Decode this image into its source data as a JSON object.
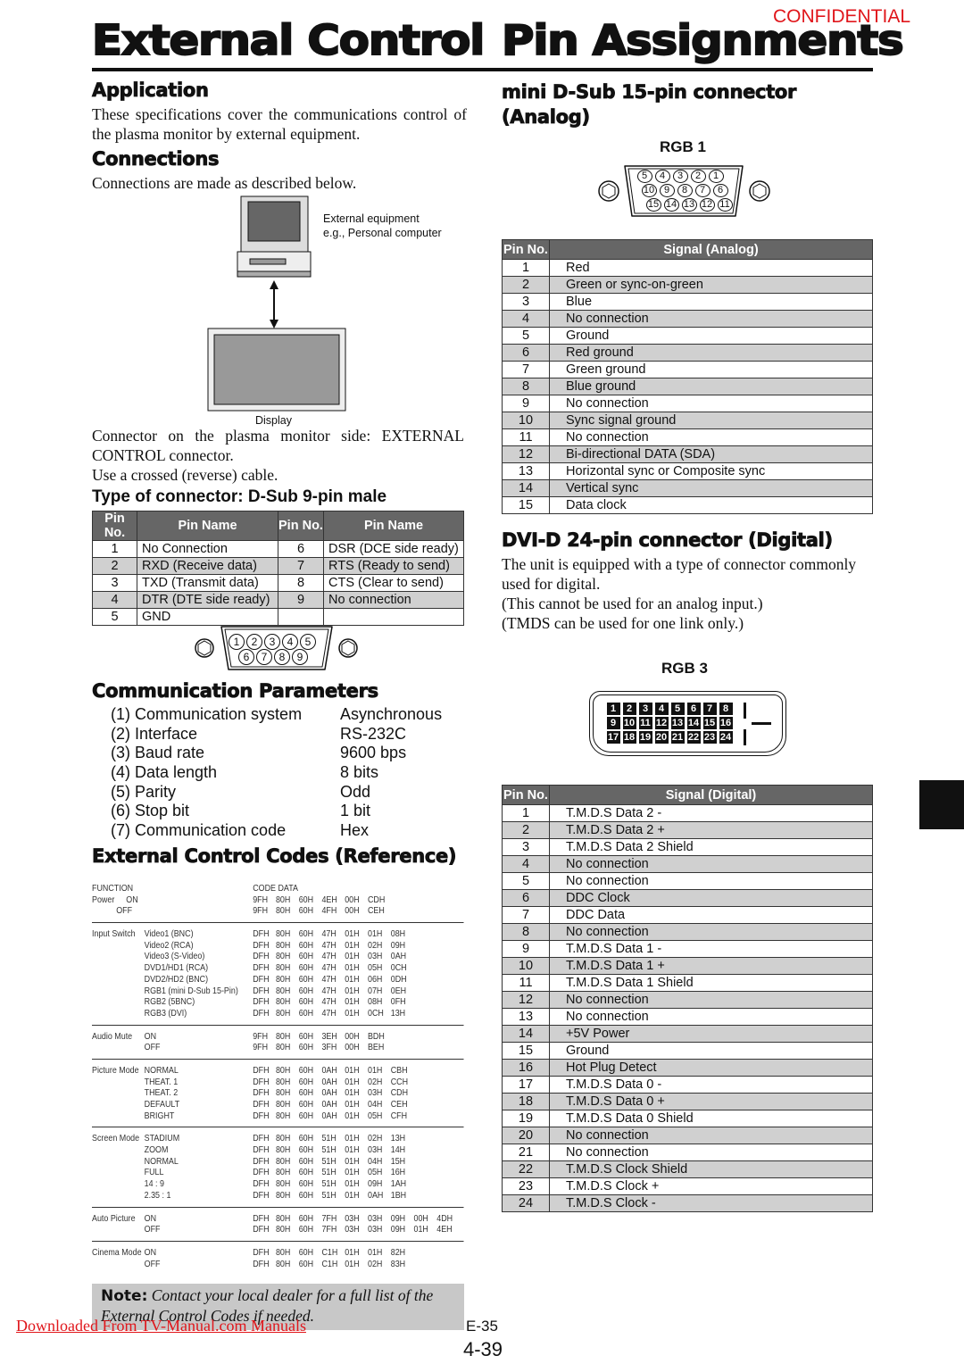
{
  "header": {
    "title_left": "External Control",
    "title_right": "Pin Assignments",
    "confidential": "CONFIDENTIAL"
  },
  "application": {
    "heading": "Application",
    "text": "These specifications cover the communications control of the plasma monitor by external equipment."
  },
  "connections": {
    "heading": "Connections",
    "text": "Connections are made as described below.",
    "equipment_label_1": "External equipment",
    "equipment_label_2": "e.g., Personal computer",
    "display_label": "Display",
    "connector_text": "Connector on the plasma monitor side: EXTERNAL CONTROL connector.",
    "cable_text": "Use a crossed (reverse) cable."
  },
  "dsub9": {
    "heading": "Type of connector: D-Sub 9-pin male",
    "headers": [
      "Pin No.",
      "Pin Name",
      "Pin No.",
      "Pin Name"
    ],
    "rows": [
      [
        "1",
        "No Connection",
        "6",
        "DSR (DCE side ready)"
      ],
      [
        "2",
        "RXD (Receive data)",
        "7",
        "RTS (Ready to send)"
      ],
      [
        "3",
        "TXD (Transmit data)",
        "8",
        "CTS (Clear to send)"
      ],
      [
        "4",
        "DTR (DTE side ready)",
        "9",
        "No connection"
      ],
      [
        "5",
        "GND",
        "",
        ""
      ]
    ],
    "pins_top": [
      "1",
      "2",
      "3",
      "4",
      "5"
    ],
    "pins_bottom": [
      "6",
      "7",
      "8",
      "9"
    ]
  },
  "comm": {
    "heading": "Communication Parameters",
    "items": [
      {
        "label": "(1) Communication system",
        "value": "Asynchronous"
      },
      {
        "label": "(2) Interface",
        "value": "RS-232C"
      },
      {
        "label": "(3) Baud rate",
        "value": "9600 bps"
      },
      {
        "label": "(4) Data length",
        "value": "8 bits"
      },
      {
        "label": "(5) Parity",
        "value": "Odd"
      },
      {
        "label": "(6) Stop bit",
        "value": "1 bit"
      },
      {
        "label": "(7) Communication code",
        "value": "Hex"
      }
    ]
  },
  "codes": {
    "heading": "External Control Codes (Reference)",
    "col_function": "FUNCTION",
    "col_code": "CODE DATA",
    "groups": [
      {
        "function": "Power",
        "entries": [
          {
            "setting": "ON",
            "codes": [
              "9FH",
              "80H",
              "60H",
              "4EH",
              "00H",
              "CDH"
            ]
          },
          {
            "setting": "OFF",
            "codes": [
              "9FH",
              "80H",
              "60H",
              "4FH",
              "00H",
              "CEH"
            ]
          }
        ]
      },
      {
        "function": "Input Switch",
        "entries": [
          {
            "setting": "Video1 (BNC)",
            "codes": [
              "DFH",
              "80H",
              "60H",
              "47H",
              "01H",
              "01H",
              "08H"
            ]
          },
          {
            "setting": "Video2 (RCA)",
            "codes": [
              "DFH",
              "80H",
              "60H",
              "47H",
              "01H",
              "02H",
              "09H"
            ]
          },
          {
            "setting": "Video3 (S-Video)",
            "codes": [
              "DFH",
              "80H",
              "60H",
              "47H",
              "01H",
              "03H",
              "0AH"
            ]
          },
          {
            "setting": "DVD1/HD1 (RCA)",
            "codes": [
              "DFH",
              "80H",
              "60H",
              "47H",
              "01H",
              "05H",
              "0CH"
            ]
          },
          {
            "setting": "DVD2/HD2 (BNC)",
            "codes": [
              "DFH",
              "80H",
              "60H",
              "47H",
              "01H",
              "06H",
              "0DH"
            ]
          },
          {
            "setting": "RGB1 (mini D-Sub 15-Pin)",
            "codes": [
              "DFH",
              "80H",
              "60H",
              "47H",
              "01H",
              "07H",
              "0EH"
            ]
          },
          {
            "setting": "RGB2 (5BNC)",
            "codes": [
              "DFH",
              "80H",
              "60H",
              "47H",
              "01H",
              "08H",
              "0FH"
            ]
          },
          {
            "setting": "RGB3 (DVI)",
            "codes": [
              "DFH",
              "80H",
              "60H",
              "47H",
              "01H",
              "0CH",
              "13H"
            ]
          }
        ]
      },
      {
        "function": "Audio Mute",
        "entries": [
          {
            "setting": "ON",
            "codes": [
              "9FH",
              "80H",
              "60H",
              "3EH",
              "00H",
              "BDH"
            ]
          },
          {
            "setting": "OFF",
            "codes": [
              "9FH",
              "80H",
              "60H",
              "3FH",
              "00H",
              "BEH"
            ]
          }
        ]
      },
      {
        "function": "Picture Mode",
        "entries": [
          {
            "setting": "NORMAL",
            "codes": [
              "DFH",
              "80H",
              "60H",
              "0AH",
              "01H",
              "01H",
              "CBH"
            ]
          },
          {
            "setting": "THEAT. 1",
            "codes": [
              "DFH",
              "80H",
              "60H",
              "0AH",
              "01H",
              "02H",
              "CCH"
            ]
          },
          {
            "setting": "THEAT. 2",
            "codes": [
              "DFH",
              "80H",
              "60H",
              "0AH",
              "01H",
              "03H",
              "CDH"
            ]
          },
          {
            "setting": "DEFAULT",
            "codes": [
              "DFH",
              "80H",
              "60H",
              "0AH",
              "01H",
              "04H",
              "CEH"
            ]
          },
          {
            "setting": "BRIGHT",
            "codes": [
              "DFH",
              "80H",
              "60H",
              "0AH",
              "01H",
              "05H",
              "CFH"
            ]
          }
        ]
      },
      {
        "function": "Screen Mode",
        "entries": [
          {
            "setting": "STADIUM",
            "codes": [
              "DFH",
              "80H",
              "60H",
              "51H",
              "01H",
              "02H",
              "13H"
            ]
          },
          {
            "setting": "ZOOM",
            "codes": [
              "DFH",
              "80H",
              "60H",
              "51H",
              "01H",
              "03H",
              "14H"
            ]
          },
          {
            "setting": "NORMAL",
            "codes": [
              "DFH",
              "80H",
              "60H",
              "51H",
              "01H",
              "04H",
              "15H"
            ]
          },
          {
            "setting": "FULL",
            "codes": [
              "DFH",
              "80H",
              "60H",
              "51H",
              "01H",
              "05H",
              "16H"
            ]
          },
          {
            "setting": "14 : 9",
            "codes": [
              "DFH",
              "80H",
              "60H",
              "51H",
              "01H",
              "09H",
              "1AH"
            ]
          },
          {
            "setting": "2.35 : 1",
            "codes": [
              "DFH",
              "80H",
              "60H",
              "51H",
              "01H",
              "0AH",
              "1BH"
            ]
          }
        ]
      },
      {
        "function": "Auto Picture",
        "entries": [
          {
            "setting": "ON",
            "codes": [
              "DFH",
              "80H",
              "60H",
              "7FH",
              "03H",
              "03H",
              "09H",
              "00H",
              "4DH"
            ]
          },
          {
            "setting": "OFF",
            "codes": [
              "DFH",
              "80H",
              "60H",
              "7FH",
              "03H",
              "03H",
              "09H",
              "01H",
              "4EH"
            ]
          }
        ]
      },
      {
        "function": "Cinema Mode",
        "entries": [
          {
            "setting": "ON",
            "codes": [
              "DFH",
              "80H",
              "60H",
              "C1H",
              "01H",
              "01H",
              "82H"
            ]
          },
          {
            "setting": "OFF",
            "codes": [
              "DFH",
              "80H",
              "60H",
              "C1H",
              "01H",
              "02H",
              "83H"
            ]
          }
        ]
      }
    ]
  },
  "note": {
    "label": "Note:",
    "text": "Contact your local dealer for a full list of the External Control Codes if needed."
  },
  "minidsub": {
    "heading": "mini D-Sub 15-pin connector (Analog)",
    "label": "RGB 1",
    "headers": [
      "Pin No.",
      "Signal (Analog)"
    ],
    "pins": [
      [
        "5",
        "4",
        "3",
        "2",
        "1"
      ],
      [
        "10",
        "9",
        "8",
        "7",
        "6"
      ],
      [
        "15",
        "14",
        "13",
        "12",
        "11"
      ]
    ],
    "rows": [
      [
        "1",
        "Red"
      ],
      [
        "2",
        "Green or sync-on-green"
      ],
      [
        "3",
        "Blue"
      ],
      [
        "4",
        "No connection"
      ],
      [
        "5",
        "Ground"
      ],
      [
        "6",
        "Red ground"
      ],
      [
        "7",
        "Green ground"
      ],
      [
        "8",
        "Blue ground"
      ],
      [
        "9",
        "No connection"
      ],
      [
        "10",
        "Sync signal ground"
      ],
      [
        "11",
        "No connection"
      ],
      [
        "12",
        "Bi-directional DATA (SDA)"
      ],
      [
        "13",
        "Horizontal sync or Composite sync"
      ],
      [
        "14",
        "Vertical sync"
      ],
      [
        "15",
        "Data clock"
      ]
    ]
  },
  "dvi": {
    "heading": "DVI-D 24-pin connector (Digital)",
    "text1": "The unit is equipped with a type of connector commonly used for digital.",
    "text2": "(This cannot be used for an analog input.)",
    "text3": "(TMDS can be used for one link only.)",
    "label": "RGB 3",
    "headers": [
      "Pin No.",
      "Signal (Digital)"
    ],
    "rows": [
      [
        "1",
        "T.M.D.S Data 2 -"
      ],
      [
        "2",
        "T.M.D.S Data 2 +"
      ],
      [
        "3",
        "T.M.D.S Data 2 Shield"
      ],
      [
        "4",
        "No connection"
      ],
      [
        "5",
        "No connection"
      ],
      [
        "6",
        "DDC Clock"
      ],
      [
        "7",
        "DDC Data"
      ],
      [
        "8",
        "No connection"
      ],
      [
        "9",
        "T.M.D.S Data 1 -"
      ],
      [
        "10",
        "T.M.D.S Data 1 +"
      ],
      [
        "11",
        "T.M.D.S Data 1 Shield"
      ],
      [
        "12",
        "No connection"
      ],
      [
        "13",
        "No connection"
      ],
      [
        "14",
        "+5V Power"
      ],
      [
        "15",
        "Ground"
      ],
      [
        "16",
        "Hot Plug Detect"
      ],
      [
        "17",
        "T.M.D.S Data 0 -"
      ],
      [
        "18",
        "T.M.D.S Data 0 +"
      ],
      [
        "19",
        "T.M.D.S Data 0 Shield"
      ],
      [
        "20",
        "No connection"
      ],
      [
        "21",
        "No connection"
      ],
      [
        "22",
        "T.M.D.S Clock Shield"
      ],
      [
        "23",
        "T.M.D.S Clock +"
      ],
      [
        "24",
        "T.M.D.S Clock -"
      ]
    ]
  },
  "footer": {
    "download_link": "Downloaded From TV-Manual.com Manuals",
    "page_e": "E-35",
    "page_num": "4-39"
  },
  "colors": {
    "confidential": "#e0161b",
    "table_header": "#666666",
    "row_alt": "#d0d0d0",
    "link": "#e0161b"
  }
}
